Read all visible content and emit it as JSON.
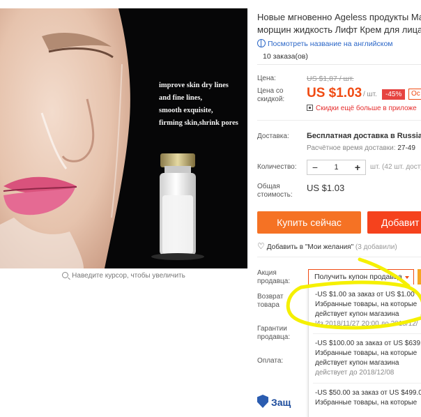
{
  "product": {
    "title_line1": "Новые мгновенно Ageless продукты Mar",
    "title_line2": "морщин жидкость Лифт Крем для лица",
    "view_english": "Посмотреть название на английском",
    "orders": "10 заказа(ов)",
    "image_overlay": [
      "improve skin dry lines",
      "and fine lines,",
      "smooth exquisite,",
      "firming skin,shrink pores"
    ],
    "zoom_hint": "Наведите курсор, чтобы увеличить"
  },
  "pricing": {
    "price_label": "Цена:",
    "old_price": "US $1,87 / шт.",
    "discount_label_line1": "Цена со",
    "discount_label_line2": "скидкой:",
    "price": "US $1.03",
    "unit": "/ шт.",
    "discount_badge": "-45%",
    "coupon_badge": "Ос",
    "app_discount": "Скидки ещё больше в приложе"
  },
  "shipping": {
    "label": "Доставка:",
    "value": "Бесплатная доставка в Russian F",
    "time_label": "Расчётное время доставки:",
    "time_value": "27-49"
  },
  "quantity": {
    "label": "Количество:",
    "minus": "−",
    "value": "1",
    "plus": "+",
    "available": "шт. (42 шт. доступ"
  },
  "total": {
    "label_line1": "Общая",
    "label_line2": "стоимость:",
    "value": "US $1.03"
  },
  "actions": {
    "buy_now": "Купить сейчас",
    "add_cart": "Добавит",
    "wishlist": "Добавить в \"Мои желания\"",
    "wishlist_count": "(3 добавили)"
  },
  "seller": {
    "promo_label_line1": "Акция",
    "promo_label_line2": "продавца:",
    "coupon_dropdown": "Получить купон продавца",
    "return_label_line1": "Возврат",
    "return_label_line2": "товара",
    "guarantee_label_line1": "Гарантии",
    "guarantee_label_line2": "продавца:",
    "payment_label": "Оплата:",
    "security": "Защ"
  },
  "coupons": [
    {
      "amount": "-US $1.00 за заказ от US $1.00",
      "desc1": "Избранные товары, на которые",
      "desc2": "действует купон магазина",
      "date": "Из 2018/11/27 20:00 до 2018/12/"
    },
    {
      "amount": "-US $100.00 за заказ от US $639.0",
      "desc1": "Избранные товары, на которые",
      "desc2": "действует купон магазина",
      "date": "действует до 2018/12/08"
    },
    {
      "amount": "-US $50.00 за заказ от US $499.00",
      "desc1": "Избранные товары, на которые",
      "desc2": "",
      "date": ""
    }
  ],
  "colors": {
    "accent_orange": "#f57224",
    "price_red": "#f04b13",
    "highlight_yellow": "#f5f000",
    "link_blue": "#2a66c7"
  }
}
